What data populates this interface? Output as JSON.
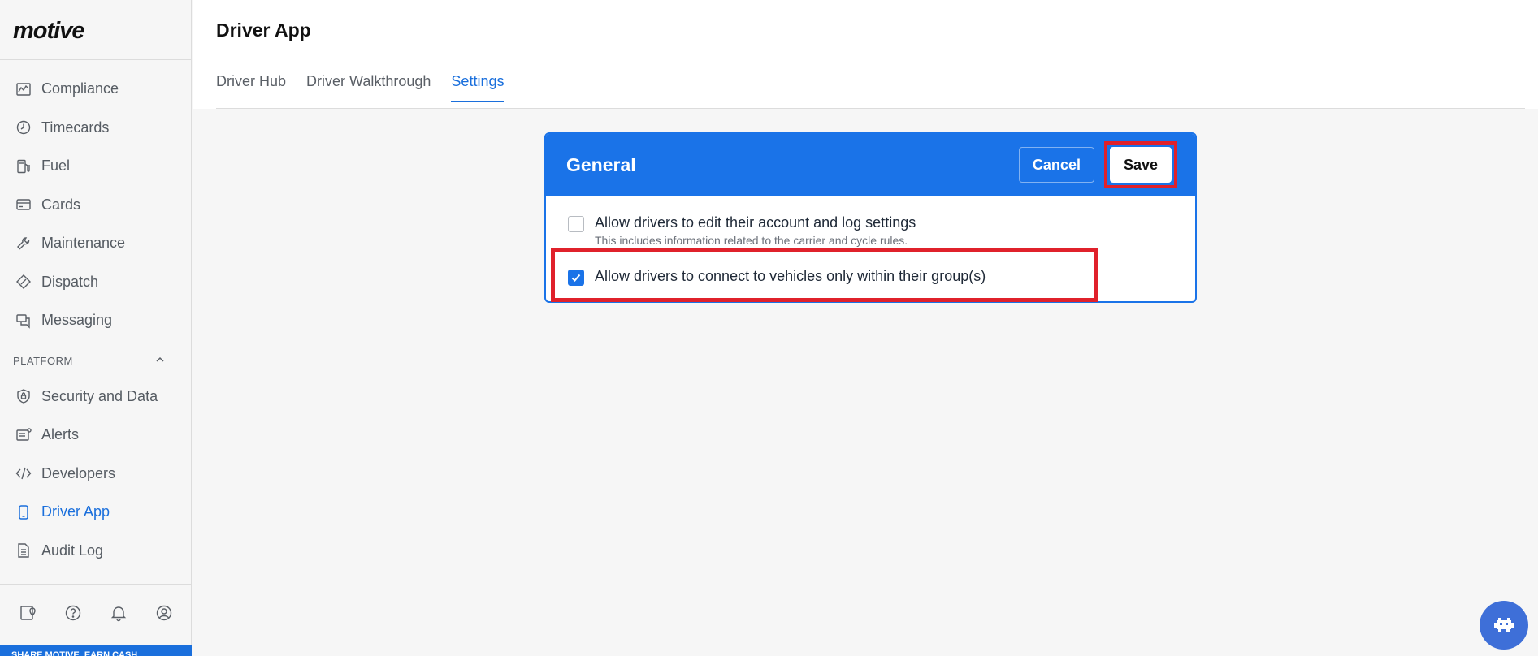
{
  "app": {
    "logo_text": "motive"
  },
  "sidebar": {
    "items": [
      {
        "label": "Compliance",
        "icon": "compliance-chart-icon"
      },
      {
        "label": "Timecards",
        "icon": "clock-icon"
      },
      {
        "label": "Fuel",
        "icon": "fuel-pump-icon"
      },
      {
        "label": "Cards",
        "icon": "credit-card-icon"
      },
      {
        "label": "Maintenance",
        "icon": "wrench-icon"
      },
      {
        "label": "Dispatch",
        "icon": "dispatch-tag-icon"
      },
      {
        "label": "Messaging",
        "icon": "chat-bubbles-icon"
      }
    ],
    "section_header": "PLATFORM",
    "platform_items": [
      {
        "label": "Security and Data",
        "icon": "shield-lock-icon"
      },
      {
        "label": "Alerts",
        "icon": "alert-list-icon"
      },
      {
        "label": "Developers",
        "icon": "code-icon"
      },
      {
        "label": "Driver App",
        "icon": "phone-icon",
        "active": true
      },
      {
        "label": "Audit Log",
        "icon": "document-icon"
      }
    ],
    "promo_text": "SHARE MOTIVE. EARN CASH."
  },
  "header": {
    "title": "Driver App",
    "tabs": [
      {
        "label": "Driver Hub"
      },
      {
        "label": "Driver Walkthrough"
      },
      {
        "label": "Settings",
        "active": true
      }
    ]
  },
  "card": {
    "title": "General",
    "cancel_label": "Cancel",
    "save_label": "Save",
    "options": [
      {
        "label": "Allow drivers to edit their account and log settings",
        "sublabel": "This includes information related to the carrier and cycle rules.",
        "checked": false
      },
      {
        "label": "Allow drivers to connect to vehicles only within their group(s)",
        "checked": true
      }
    ]
  },
  "colors": {
    "accent": "#1a73e8",
    "highlight": "#e0212b"
  }
}
